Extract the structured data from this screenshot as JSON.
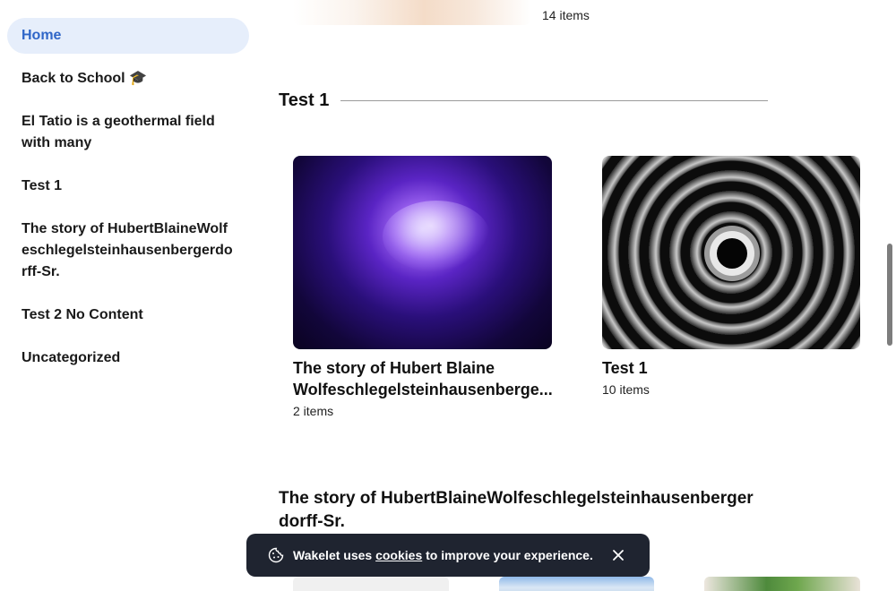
{
  "sidebar": {
    "items": [
      {
        "label": "Home",
        "active": true
      },
      {
        "label": "Back to School",
        "emoji": "🎓"
      },
      {
        "label": "El Tatio is a geothermal field with many"
      },
      {
        "label": "Test 1"
      },
      {
        "label": "The story of HubertBlaineWolfeschlegelsteinhausenbergerdorff-Sr."
      },
      {
        "label": "Test 2 No Content"
      },
      {
        "label": "Uncategorized"
      }
    ]
  },
  "top_card": {
    "count": "14 items"
  },
  "sections": [
    {
      "title": "Test 1",
      "cards": [
        {
          "title": "The story of Hubert Blaine Wolfeschlegelsteinhausenberge...",
          "count": "2 items",
          "thumb": "purple-orb"
        },
        {
          "title": "Test 1",
          "count": "10 items",
          "thumb": "spiral-tunnel"
        }
      ]
    },
    {
      "title": "The story of HubertBlaineWolfeschlegelsteinhausenbergerdorff-Sr."
    }
  ],
  "toast": {
    "prefix": "Wakelet uses ",
    "link": "cookies",
    "suffix": " to improve your experience.",
    "icon": "cookie-icon",
    "close_icon": "close-icon"
  },
  "colors": {
    "accent": "#2f66c8",
    "active_bg": "#e6eefb",
    "toast_bg": "#1f2430"
  }
}
